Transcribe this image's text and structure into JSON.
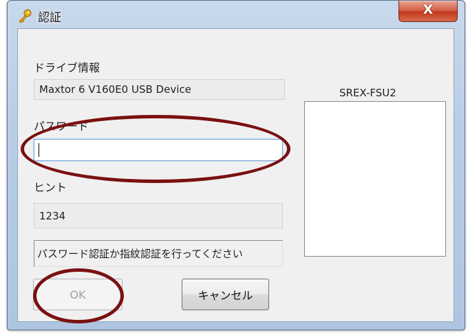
{
  "window": {
    "title": "認証",
    "close_glyph": "X"
  },
  "drive_info": {
    "label": "ドライブ情報",
    "value": "Maxtor 6 V160E0 USB Device"
  },
  "password": {
    "label": "パスワード",
    "value": ""
  },
  "hint": {
    "label": "ヒント",
    "value": "1234"
  },
  "status": {
    "message": "パスワード認証か指紋認証を行ってください"
  },
  "buttons": {
    "ok_label": "OK",
    "cancel_label": "キャンセル"
  },
  "device_panel": {
    "title": "SREX-FSU2"
  },
  "annotation_color": "#7a1010"
}
